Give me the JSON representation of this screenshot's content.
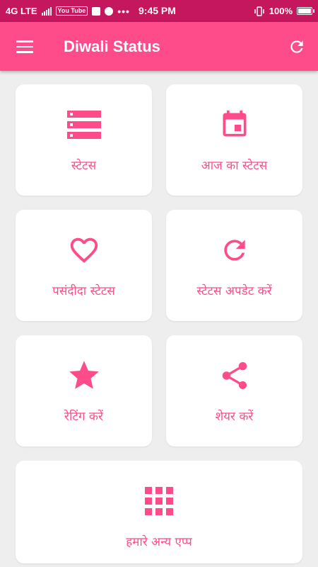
{
  "status_bar": {
    "network": "4G LTE",
    "youtube": "You Tube",
    "overflow": "•••",
    "time": "9:45 PM",
    "battery": "100%"
  },
  "app_bar": {
    "title": "Diwali Status",
    "menu_icon": "hamburger-menu-icon",
    "refresh_icon": "refresh-icon"
  },
  "colors": {
    "status_bar": "#c5175e",
    "app_bar": "#fe4c8b",
    "accent": "#fe4c8b",
    "background": "#eeeeee",
    "card": "#ffffff"
  },
  "tiles": [
    {
      "label": "स्टेटस",
      "icon": "list-icon"
    },
    {
      "label": "आज का स्टेटस",
      "icon": "calendar-icon"
    },
    {
      "label": "पसंदीदा स्टेटस",
      "icon": "heart-icon"
    },
    {
      "label": "स्टेटस अपडेट करें",
      "icon": "refresh-icon"
    },
    {
      "label": "रेटिंग करें",
      "icon": "star-icon"
    },
    {
      "label": "शेयर करें",
      "icon": "share-icon"
    },
    {
      "label": "हमारे अन्य एप्प",
      "icon": "apps-grid-icon"
    }
  ]
}
